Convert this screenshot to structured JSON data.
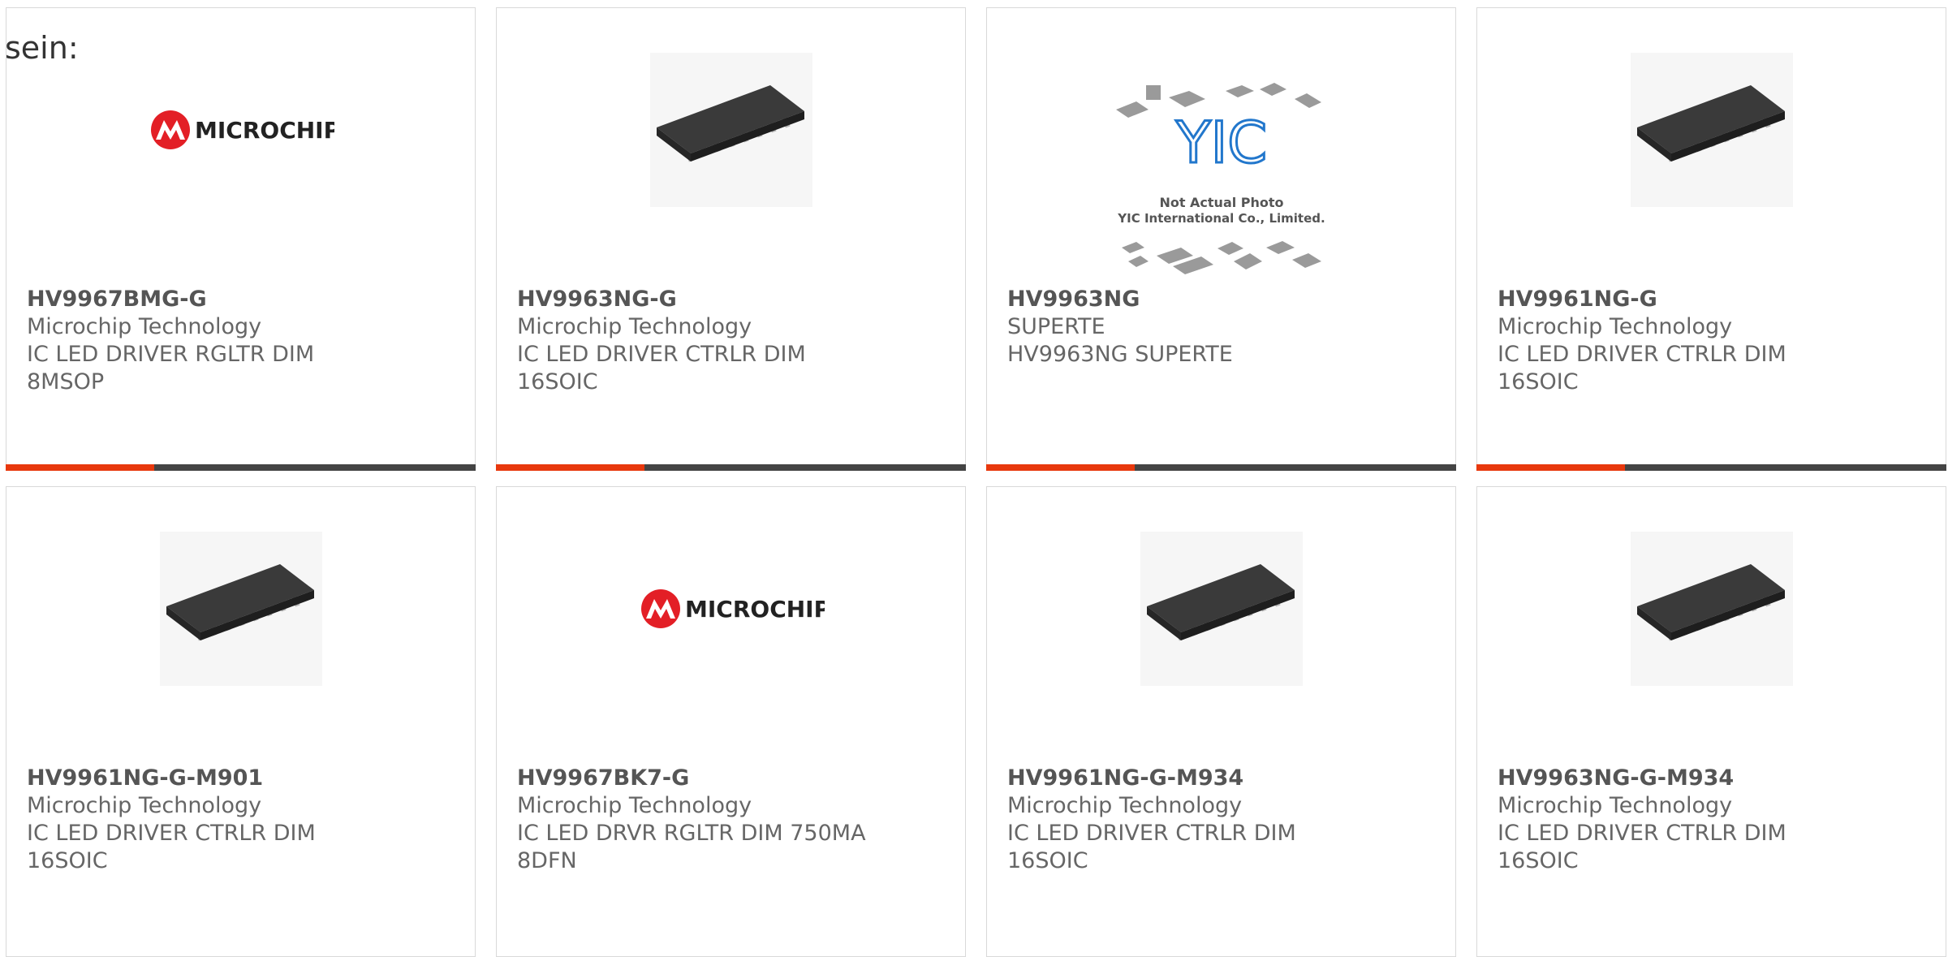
{
  "lead_text": "sein:",
  "colors": {
    "accent": "#e8380d",
    "bar": "#444444",
    "border": "#d9d9d9"
  },
  "products": [
    {
      "part": "HV9967BMG-G",
      "maker": "Microchip Technology",
      "desc1": "IC LED DRIVER RGLTR DIM",
      "desc2": "8MSOP",
      "image": "microchip-logo"
    },
    {
      "part": "HV9963NG-G",
      "maker": "Microchip Technology",
      "desc1": "IC LED DRIVER CTRLR DIM",
      "desc2": "16SOIC",
      "image": "soic-chip"
    },
    {
      "part": "HV9963NG",
      "maker": "SUPERTE",
      "desc1": "HV9963NG SUPERTE",
      "desc2": "",
      "image": "yic-placeholder",
      "placeholder_text": {
        "brand": "YIC",
        "line1": "Not Actual Photo",
        "line2": "YIC International Co., Limited."
      }
    },
    {
      "part": "HV9961NG-G",
      "maker": "Microchip Technology",
      "desc1": "IC LED DRIVER CTRLR DIM",
      "desc2": "16SOIC",
      "image": "soic-chip"
    },
    {
      "part": "HV9961NG-G-M901",
      "maker": "Microchip Technology",
      "desc1": "IC LED DRIVER CTRLR DIM",
      "desc2": "16SOIC",
      "image": "soic-chip"
    },
    {
      "part": "HV9967BK7-G",
      "maker": "Microchip Technology",
      "desc1": "IC LED DRVR RGLTR DIM 750MA",
      "desc2": "8DFN",
      "image": "microchip-logo"
    },
    {
      "part": "HV9961NG-G-M934",
      "maker": "Microchip Technology",
      "desc1": "IC LED DRIVER CTRLR DIM",
      "desc2": "16SOIC",
      "image": "soic-chip"
    },
    {
      "part": "HV9963NG-G-M934",
      "maker": "Microchip Technology",
      "desc1": "IC LED DRIVER CTRLR DIM",
      "desc2": "16SOIC",
      "image": "soic-chip"
    }
  ],
  "microchip_logo_text": "MICROCHIP"
}
